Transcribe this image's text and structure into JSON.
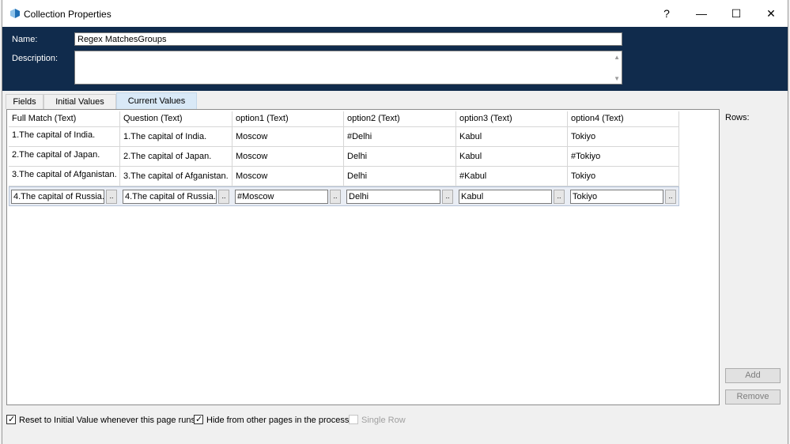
{
  "window": {
    "title": "Collection Properties",
    "help_label": "?",
    "minimize_label": "—",
    "maximize_label": "☐",
    "close_label": "✕"
  },
  "header": {
    "name_label": "Name:",
    "name_value": "Regex MatchesGroups",
    "description_label": "Description:",
    "description_value": ""
  },
  "tabs": [
    {
      "label": "Fields",
      "active": false
    },
    {
      "label": "Initial Values",
      "active": false
    },
    {
      "label": "Current Values",
      "active": true
    }
  ],
  "grid": {
    "columns": [
      "Full Match  (Text)",
      "Question  (Text)",
      "option1  (Text)",
      "option2  (Text)",
      "option3  (Text)",
      "option4  (Text)"
    ],
    "rows": [
      [
        "1.The capital of India.",
        "1.The capital of India.",
        "Moscow",
        "#Delhi",
        "Kabul",
        "Tokiyo"
      ],
      [
        "2.The capital of Japan.",
        "2.The capital of Japan.",
        "Moscow",
        "Delhi",
        "Kabul",
        "#Tokiyo"
      ],
      [
        "3.The capital of Afganistan.",
        "3.The capital of Afganistan.",
        "Moscow",
        "Delhi",
        "#Kabul",
        "Tokiyo"
      ]
    ],
    "edit_row": [
      "4.The capital of Russia.",
      "4.The capital of Russia.",
      "#Moscow",
      "Delhi",
      "Kabul",
      "Tokiyo"
    ],
    "ellipsis_label": ".."
  },
  "side": {
    "rows_label": "Rows:",
    "add_label": "Add",
    "remove_label": "Remove"
  },
  "footer": {
    "reset_label": "Reset to Initial Value whenever this page runs",
    "reset_checked": true,
    "hide_label": "Hide from other pages in the process",
    "hide_checked": true,
    "single_row_label": "Single Row",
    "single_row_checked": false
  },
  "colors": {
    "header_bg": "#102b4c",
    "active_tab": "#d9e9f7"
  }
}
